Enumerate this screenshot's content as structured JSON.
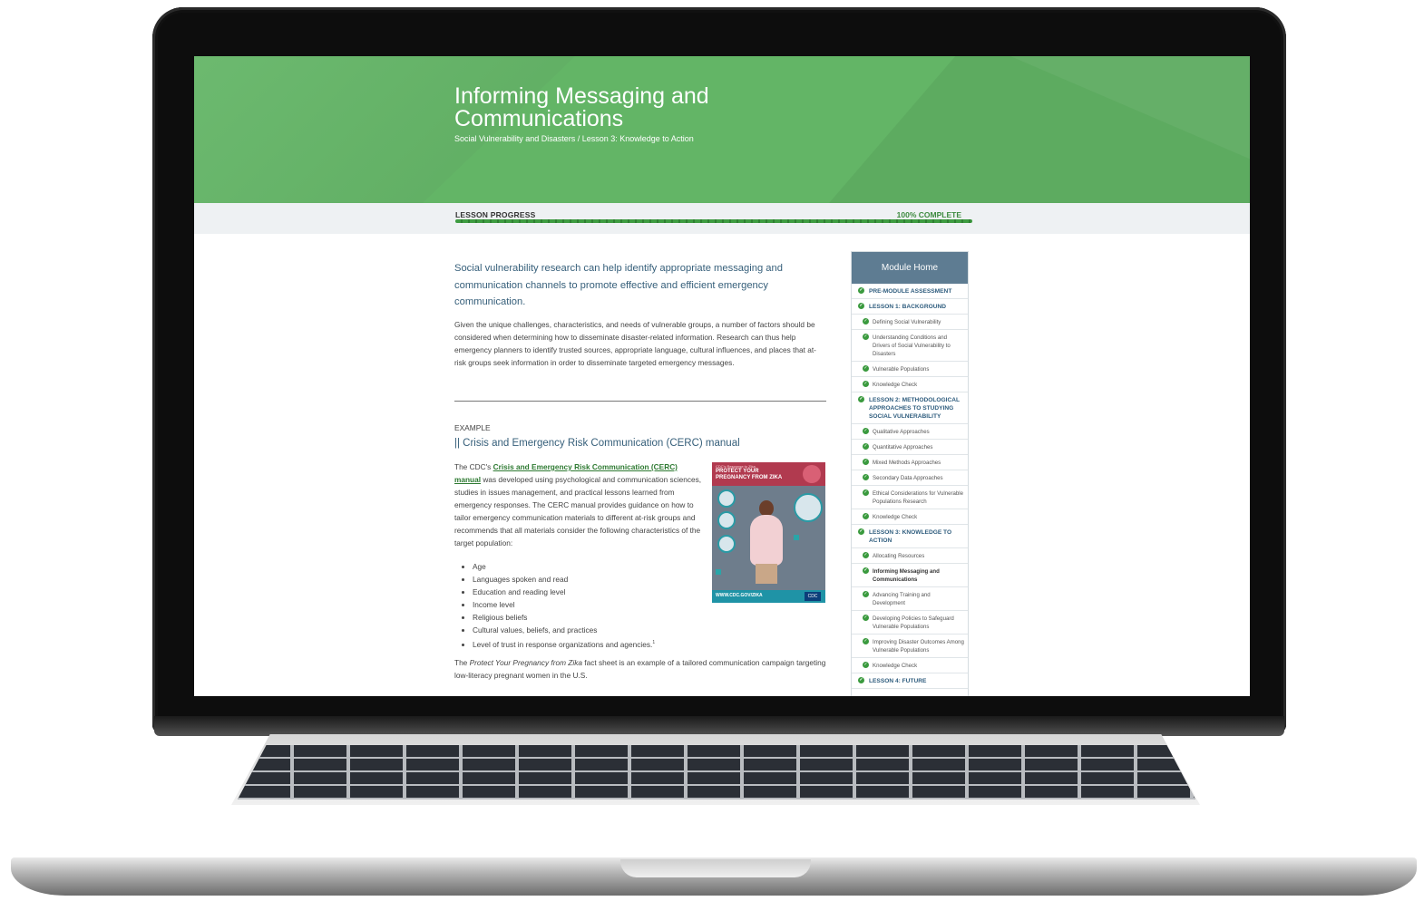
{
  "header": {
    "title": "Informing Messaging and Communications",
    "breadcrumb": "Social Vulnerability and Disasters / Lesson 3: Knowledge to Action"
  },
  "progress": {
    "label": "LESSON PROGRESS",
    "status": "100% COMPLETE",
    "value": 100
  },
  "content": {
    "lead": "Social vulnerability research can help identify appropriate messaging and communication channels to promote effective and efficient emergency communication.",
    "body": "Given the unique challenges, characteristics, and needs of vulnerable groups, a number of factors should be considered when determining how to disseminate disaster-related information. Research can thus help emergency planners to identify trusted sources, appropriate language, cultural influences, and places that at-risk groups seek information in order to disseminate targeted emergency messages.",
    "example_label": "EXAMPLE",
    "example_title": "|| Crisis and Emergency Risk Communication (CERC) manual",
    "cerc_intro": "The CDC's ",
    "cerc_link": "Crisis and Emergency Risk Communication (CERC) manual",
    "cerc_rest": " was developed using psychological and communication sciences, studies in issues management, and practical lessons learned from emergency responses. The CERC manual provides guidance on how to tailor emergency communication materials to different at-risk groups and recommends that all materials consider the following characteristics of the target population:",
    "bullets": [
      "Age",
      "Languages spoken and read",
      "Education and reading level",
      "Income level",
      "Religious beliefs",
      "Cultural values, beliefs, and practices",
      "Level of trust in response organizations and agencies."
    ],
    "footnote": "1",
    "closing_pre": "The ",
    "closing_em": "Protect Your Pregnancy from Zika",
    "closing_post": " fact sheet is an example of a tailored communication campaign targeting low-literacy pregnant women in the U.S."
  },
  "poster": {
    "org": "CDC's Response to Zika",
    "title": "PROTECT YOUR PREGNANCY FROM ZIKA",
    "url": "WWW.CDC.GOV/ZIKA",
    "logo": "CDC",
    "accent": "#b13a4f"
  },
  "sidebar": {
    "title": "Module Home",
    "items": [
      {
        "label": "PRE-MODULE ASSESSMENT",
        "level": "lesson"
      },
      {
        "label": "LESSON 1: BACKGROUND",
        "level": "lesson"
      },
      {
        "label": "Defining Social Vulnerability",
        "level": "sub"
      },
      {
        "label": "Understanding Conditions and Drivers of Social Vulnerability to Disasters",
        "level": "sub"
      },
      {
        "label": "Vulnerable Populations",
        "level": "sub"
      },
      {
        "label": "Knowledge Check",
        "level": "sub"
      },
      {
        "label": "LESSON 2: METHODOLOGICAL APPROACHES TO STUDYING SOCIAL VULNERABILITY",
        "level": "lesson"
      },
      {
        "label": "Qualitative Approaches",
        "level": "sub"
      },
      {
        "label": "Quantitative Approaches",
        "level": "sub"
      },
      {
        "label": "Mixed Methods Approaches",
        "level": "sub"
      },
      {
        "label": "Secondary Data Approaches",
        "level": "sub"
      },
      {
        "label": "Ethical Considerations for Vulnerable Populations Research",
        "level": "sub"
      },
      {
        "label": "Knowledge Check",
        "level": "sub"
      },
      {
        "label": "LESSON 3: KNOWLEDGE TO ACTION",
        "level": "lesson"
      },
      {
        "label": "Allocating Resources",
        "level": "sub"
      },
      {
        "label": "Informing Messaging and Communications",
        "level": "sub",
        "current": true
      },
      {
        "label": "Advancing Training and Development",
        "level": "sub"
      },
      {
        "label": "Developing Policies to Safeguard Vulnerable Populations",
        "level": "sub"
      },
      {
        "label": "Improving Disaster Outcomes Among Vulnerable Populations",
        "level": "sub"
      },
      {
        "label": "Knowledge Check",
        "level": "sub"
      },
      {
        "label": "LESSON 4: FUTURE",
        "level": "lesson"
      }
    ]
  },
  "colors": {
    "hero": "#63b566",
    "link": "#2e7a32",
    "heading": "#365f7a",
    "sidebar_head": "#5e7c92"
  }
}
